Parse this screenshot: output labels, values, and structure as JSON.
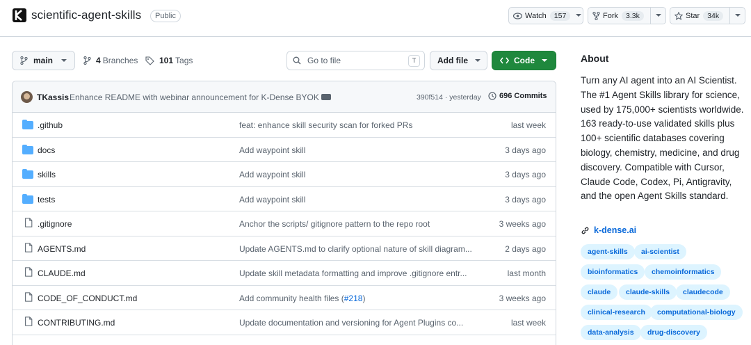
{
  "repo": {
    "name": "scientific-agent-skills",
    "visibility": "Public"
  },
  "header_actions": {
    "watch_label": "Watch",
    "watch_count": "157",
    "fork_label": "Fork",
    "fork_count": "3.3k",
    "star_label": "Star",
    "star_count": "34k"
  },
  "toolbar": {
    "branch": "main",
    "branches_count": "4",
    "branches_label": "Branches",
    "tags_count": "101",
    "tags_label": "Tags",
    "search_placeholder": "Go to file",
    "search_shortcut": "T",
    "add_file_label": "Add file",
    "code_label": "Code"
  },
  "latest_commit": {
    "author": "TKassis",
    "message": "Enhance README with webinar announcement for K-Dense BYOK",
    "hash_time": "390f514 · yesterday",
    "commits_count": "696 Commits"
  },
  "files": [
    {
      "name": ".github",
      "type": "folder",
      "message": "feat: enhance skill security scan for forked PRs",
      "time": "last week"
    },
    {
      "name": "docs",
      "type": "folder",
      "message": "Add waypoint skill",
      "time": "3 days ago"
    },
    {
      "name": "skills",
      "type": "folder",
      "message": "Add waypoint skill",
      "time": "3 days ago"
    },
    {
      "name": "tests",
      "type": "folder",
      "message": "Add waypoint skill",
      "time": "3 days ago"
    },
    {
      "name": ".gitignore",
      "type": "file",
      "message": "Anchor the scripts/ gitignore pattern to the repo root",
      "time": "3 weeks ago"
    },
    {
      "name": "AGENTS.md",
      "type": "file",
      "message": "Update AGENTS.md to clarify optional nature of skill diagram...",
      "time": "2 days ago"
    },
    {
      "name": "CLAUDE.md",
      "type": "file",
      "message": "Update skill metadata formatting and improve .gitignore entr...",
      "time": "last month"
    },
    {
      "name": "CODE_OF_CONDUCT.md",
      "type": "file",
      "message": "Add community health files (",
      "message_link": "#218",
      "message_suffix": ")",
      "time": "3 weeks ago"
    },
    {
      "name": "CONTRIBUTING.md",
      "type": "file",
      "message": "Update documentation and versioning for Agent Plugins co...",
      "time": "last week"
    }
  ],
  "about": {
    "heading": "About",
    "description": "Turn any AI agent into an AI Scientist. The #1 Agent Skills library for science, used by 175,000+ scientists worldwide. 163 ready-to-use validated skills plus 100+ scientific databases covering biology, chemistry, medicine, and drug discovery. Compatible with Cursor, Claude Code, Codex, Pi, Antigravity, and the open Agent Skills standard.",
    "homepage": "k-dense.ai",
    "topics": [
      "agent-skills",
      "ai-scientist",
      "bioinformatics",
      "chemoinformatics",
      "claude",
      "claude-skills",
      "claudecode",
      "clinical-research",
      "computational-biology",
      "data-analysis",
      "drug-discovery"
    ]
  },
  "colors": {
    "accent": "#0969da",
    "code_button": "#1f883d",
    "folder": "#54aeff",
    "topic_bg": "#ddf4ff"
  }
}
